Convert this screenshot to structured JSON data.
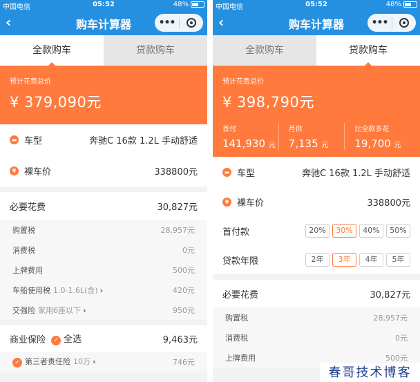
{
  "status": {
    "carrier": "中国电信",
    "time": "05:52",
    "battery": "48%",
    "battery_level": 0.48
  },
  "nav": {
    "back_icon": "chevron-left-icon",
    "title": "购车计算器",
    "more": "•••"
  },
  "tabs": {
    "full": "全款购车",
    "loan": "贷款购车"
  },
  "left": {
    "total_label": "预计花费总价",
    "total_amount": "¥ 379,090元",
    "model_label": "车型",
    "model_value": "奔驰C 16款 1.2L 手动舒适",
    "price_label": "裸车价",
    "price_value": "338800元",
    "required_label": "必要花费",
    "required_value": "30,827元",
    "items": [
      {
        "label": "购置税",
        "note": "",
        "value": "28,957元"
      },
      {
        "label": "消费税",
        "note": "",
        "value": "0元"
      },
      {
        "label": "上牌费用",
        "note": "",
        "value": "500元"
      },
      {
        "label": "车船使用税",
        "note": "1.0-1.6L(含)",
        "value": "420元"
      },
      {
        "label": "交强险",
        "note": "家用6座以下",
        "value": "950元"
      }
    ],
    "insurance_label": "商业保险",
    "select_all": "全选",
    "insurance_value": "9,463元",
    "third_party_label": "第三者责任险",
    "third_party_note": "10万",
    "third_party_value": "746元"
  },
  "right": {
    "total_label": "预计花费总价",
    "total_amount": "¥ 398,790元",
    "down_label": "首付",
    "down_value": "141,930",
    "down_unit": "元",
    "monthly_label": "月供",
    "monthly_value": "7,135",
    "monthly_unit": "元",
    "more_label": "比全款多花",
    "more_value": "19,700",
    "more_unit": "元",
    "model_label": "车型",
    "model_value": "奔驰C 16款 1.2L 手动舒适",
    "price_label": "裸车价",
    "price_value": "338800元",
    "down_pct_label": "首付款",
    "down_pct_options": [
      "20%",
      "30%",
      "40%",
      "50%"
    ],
    "term_label": "贷款年限",
    "term_options": [
      "2年",
      "3年",
      "4年",
      "5年"
    ],
    "required_label": "必要花费",
    "required_value": "30,827元",
    "items": [
      {
        "label": "购置税",
        "value": "28,957元"
      },
      {
        "label": "消费税",
        "value": "0元"
      },
      {
        "label": "上牌费用",
        "value": "500元"
      }
    ]
  },
  "watermark": "春哥技术博客",
  "colors": {
    "accent": "#ff7a3c",
    "nav": "#2590e0"
  }
}
